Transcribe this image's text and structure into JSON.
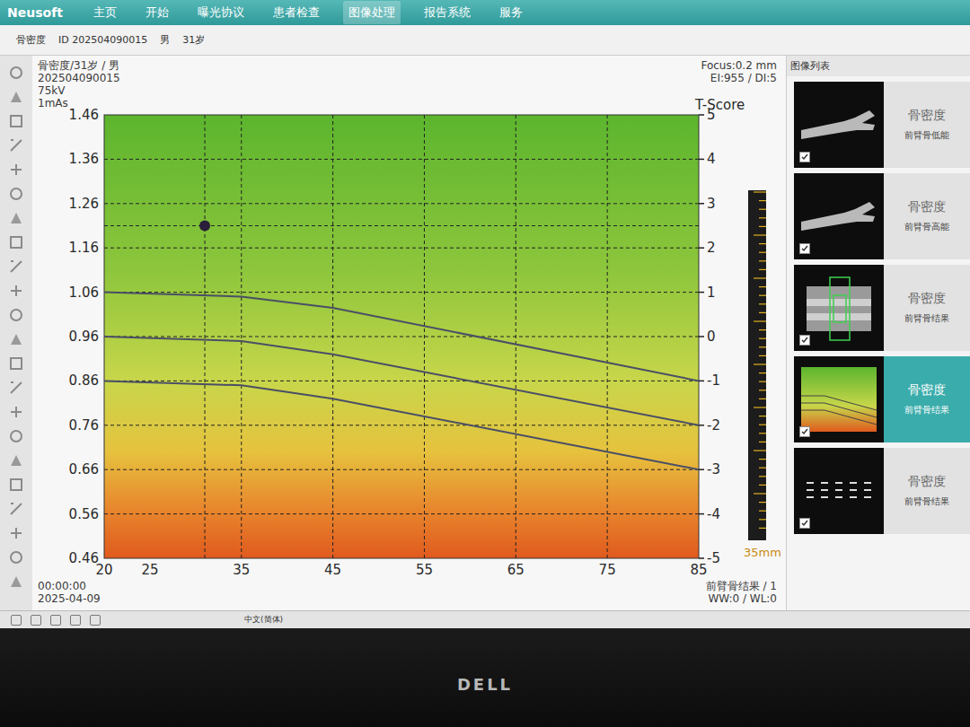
{
  "app": {
    "logo": "Neusoft"
  },
  "nav": [
    {
      "label": "主页",
      "selected": false
    },
    {
      "label": "开始",
      "selected": false
    },
    {
      "label": "曝光协议",
      "selected": false
    },
    {
      "label": "患者检查",
      "selected": false
    },
    {
      "label": "图像处理",
      "selected": true
    },
    {
      "label": "报告系统",
      "selected": false
    },
    {
      "label": "服务",
      "selected": false
    }
  ],
  "patient_bar": {
    "exam": "骨密度",
    "id": "ID 202504090015",
    "sex": "男",
    "age": "31岁"
  },
  "viewport": {
    "overlay_top_left": [
      "骨密度/31岁 / 男",
      "202504090015",
      "75kV",
      "1mAs"
    ],
    "overlay_top_right": [
      "Focus:0.2 mm",
      "EI:955 / DI:5"
    ],
    "overlay_bottom_left": [
      "00:00:00",
      "2025-04-09"
    ],
    "overlay_bottom_right": [
      "前臂骨结果 / 1",
      "WW:0 / WL:0"
    ],
    "ruler_label": "35mm"
  },
  "chart": {
    "y_ticks": [
      "1.46",
      "1.36",
      "1.26",
      "1.16",
      "1.06",
      "0.96",
      "0.86",
      "0.76",
      "0.66",
      "0.56",
      "0.46"
    ],
    "t_axis_title": "T-Score",
    "t_ticks": [
      "5",
      "4",
      "3",
      "2",
      "1",
      "0",
      "-1",
      "-2",
      "-3",
      "-4",
      "-5"
    ],
    "x_ticks": [
      "20",
      "25",
      "35",
      "45",
      "55",
      "65",
      "75",
      "85"
    ],
    "curve_ages": [
      20,
      35,
      45,
      85
    ],
    "reference_curves": [
      {
        "values": [
          1.06,
          1.05,
          1.025,
          0.86
        ]
      },
      {
        "values": [
          0.96,
          0.95,
          0.92,
          0.76
        ]
      },
      {
        "values": [
          0.86,
          0.85,
          0.82,
          0.66
        ]
      }
    ],
    "patient_point": {
      "age": 31,
      "bmd": 1.21
    }
  },
  "image_list": {
    "title": "图像列表",
    "items": [
      {
        "title": "骨密度",
        "subtitle": "前臂骨低能",
        "kind": "xray",
        "checked": true,
        "selected": false
      },
      {
        "title": "骨密度",
        "subtitle": "前臂骨高能",
        "kind": "xray",
        "checked": true,
        "selected": false
      },
      {
        "title": "骨密度",
        "subtitle": "前臂骨结果",
        "kind": "roi",
        "checked": true,
        "selected": false
      },
      {
        "title": "骨密度",
        "subtitle": "前臂骨结果",
        "kind": "chart",
        "checked": true,
        "selected": true
      },
      {
        "title": "骨密度",
        "subtitle": "前臂骨结果",
        "kind": "table",
        "checked": true,
        "selected": false
      }
    ]
  },
  "status_bar": {
    "ime": "中文(简体)"
  },
  "monitor": {
    "brand": "DELL"
  }
}
